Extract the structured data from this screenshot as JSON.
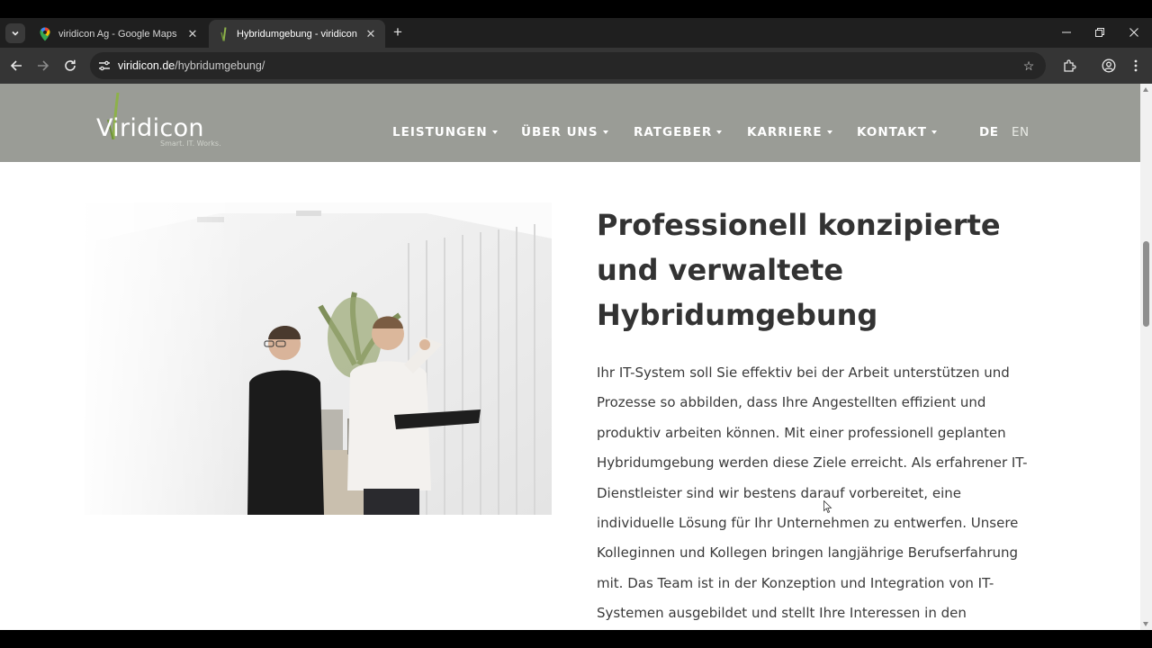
{
  "browser": {
    "tabs": [
      {
        "title": "viridicon Ag - Google Maps",
        "icon": "maps-pin-icon",
        "active": false
      },
      {
        "title": "Hybridumgebung - viridicon",
        "icon": "viridicon-favicon",
        "active": true
      }
    ],
    "url_host": "viridicon.de",
    "url_path": "/hybridumgebung/",
    "new_tab_label": "+"
  },
  "site": {
    "logo_text": "Viridicon",
    "logo_tagline": "Smart. IT. Works.",
    "nav": [
      {
        "label": "LEISTUNGEN"
      },
      {
        "label": "ÜBER UNS"
      },
      {
        "label": "RATGEBER"
      },
      {
        "label": "KARRIERE"
      },
      {
        "label": "KONTAKT"
      }
    ],
    "languages": [
      {
        "label": "DE",
        "active": true
      },
      {
        "label": "EN",
        "active": false
      }
    ],
    "header_color": "#9a9c96"
  },
  "content": {
    "headline": "Professionell konzipierte und verwaltete Hybridumgebung",
    "body": "Ihr IT-System soll Sie effektiv bei der Arbeit unterstützen und Prozesse so abbilden, dass Ihre Angestellten effizient und produktiv arbeiten können. Mit einer professionell geplanten Hybridumgebung werden diese Ziele erreicht. Als erfahrener IT-Dienstleister sind wir bestens darauf vorbereitet, eine individuelle Lösung für Ihr Unternehmen zu entwerfen. Unsere Kolleginnen und Kollegen bringen langjährige Berufserfahrung mit. Das Team ist in der Konzeption und Integration von IT-Systemen ausgebildet und stellt Ihre Interessen in den Mittelpunkt."
  }
}
